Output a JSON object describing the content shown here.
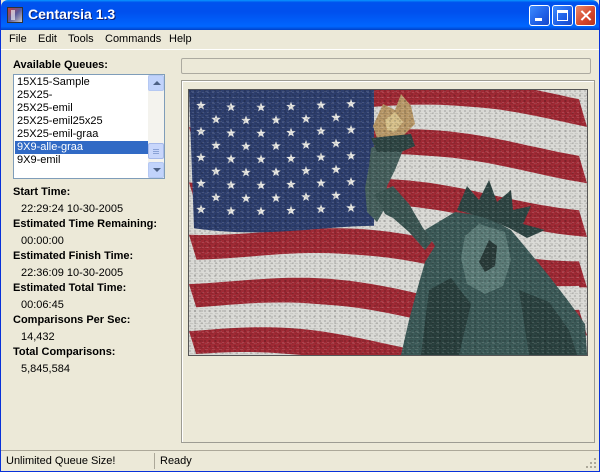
{
  "window": {
    "title": "Centarsia 1.3"
  },
  "menu": [
    "File",
    "Edit",
    "Tools",
    "Commands",
    "Help"
  ],
  "queues": {
    "label": "Available Queues:",
    "items": [
      "15X15-Sample",
      "25X25-",
      "25X25-emil",
      "25X25-emil25x25",
      "25X25-emil-graa",
      "9X9-alle-graa",
      "9X9-emil"
    ],
    "selected_index": 5
  },
  "stats": {
    "start_time_label": "Start Time:",
    "start_time": "22:29:24 10-30-2005",
    "time_remaining_label": "Estimated Time Remaining:",
    "time_remaining": "00:00:00",
    "finish_time_label": "Estimated Finish Time:",
    "finish_time": "22:36:09 10-30-2005",
    "total_time_label": "Estimated Total Time:",
    "total_time": "00:06:45",
    "comparisons_per_sec_label": "Comparisons Per Sec:",
    "comparisons_per_sec": "14,432",
    "total_comparisons_label": "Total Comparisons:",
    "total_comparisons": "5,845,584"
  },
  "progress": {
    "fraction": 0
  },
  "statusbar": {
    "pane1": "Unlimited Queue Size!",
    "pane2": "Ready"
  },
  "colors": {
    "flag_red": "#a02a35",
    "flag_white": "#d8d8d4",
    "flag_blue": "#2e3f6e",
    "statue": "#3c5a5a",
    "torch_flame": "#b89868",
    "selection": "#316ac5"
  },
  "icons": [
    "app-icon",
    "minimize-icon",
    "maximize-icon",
    "close-icon",
    "scroll-up-icon",
    "scroll-down-icon",
    "size-grip-icon"
  ]
}
